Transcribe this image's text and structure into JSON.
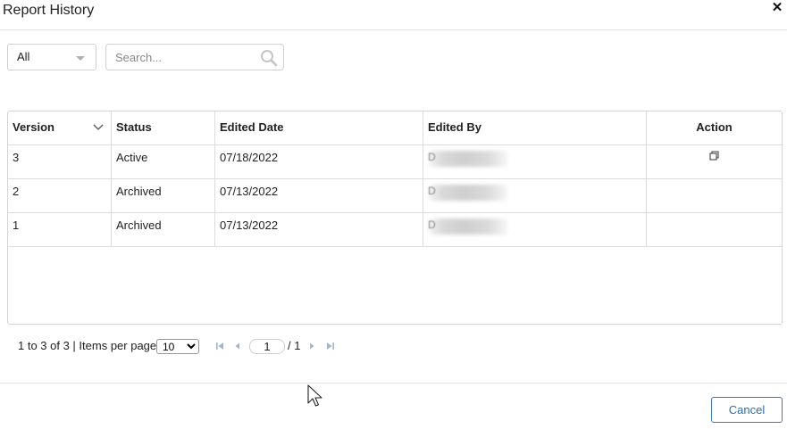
{
  "dialog": {
    "title": "Report History",
    "close_icon": "close-icon"
  },
  "filters": {
    "status_select": {
      "value": "All",
      "options": [
        "All"
      ]
    },
    "search": {
      "placeholder": "Search...",
      "value": "",
      "icon": "search-icon"
    }
  },
  "grid": {
    "columns": [
      "Version",
      "Status",
      "Edited Date",
      "Edited By",
      "Action"
    ],
    "sort_icon": "chevron-down-icon",
    "rows": [
      {
        "version": "3",
        "status": "Active",
        "edited_date": "07/18/2022",
        "edited_by": "D",
        "action_icon": "restore-icon"
      },
      {
        "version": "2",
        "status": "Archived",
        "edited_date": "07/13/2022",
        "edited_by": "D",
        "action_icon": ""
      },
      {
        "version": "1",
        "status": "Archived",
        "edited_date": "07/13/2022",
        "edited_by": "D",
        "action_icon": ""
      }
    ]
  },
  "pager": {
    "summary": "1 to 3 of 3 | Items per page",
    "items_per_page": "10",
    "items_per_page_options": [
      "10"
    ],
    "current_page": "1",
    "total_pages": "/ 1",
    "icons": [
      "first-page-icon",
      "previous-page-icon",
      "next-page-icon",
      "last-page-icon"
    ]
  },
  "footer": {
    "cancel_label": "Cancel"
  },
  "colors": {
    "accent": "#2e6db4",
    "border": "#d4d4d4",
    "pager_icon": "#9fb6cc"
  }
}
